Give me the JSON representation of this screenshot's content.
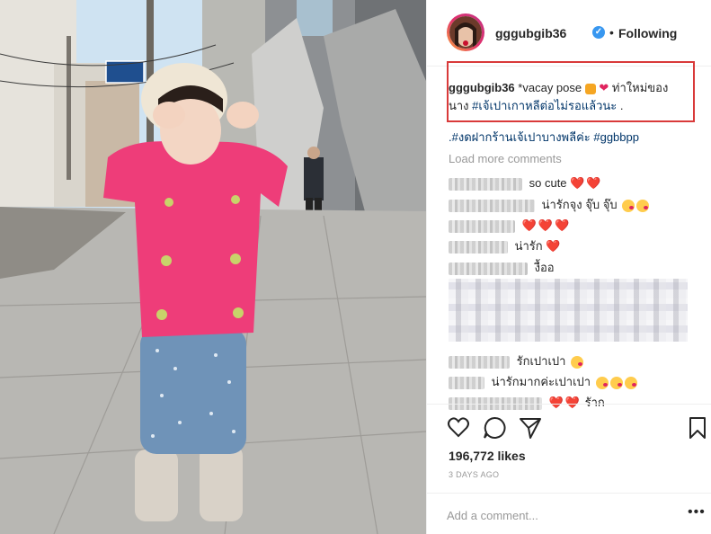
{
  "post": {
    "username": "gggubgib36",
    "verified_badge": "✓",
    "dot": "•",
    "follow_status": "Following"
  },
  "caption": {
    "username": "gggubgib36",
    "text_before": "*vacay pose",
    "text_thai_1": "ท่าใหม่ของ",
    "text_thai_2": "นาง",
    "hashtag_1": "#เจ้เปาเกาหลีต่อไม่รอแล้วนะ",
    "period": ".",
    "line2": ".#งดฝากร้านเจ้เปาบางพลีค่ะ #ggbbpp"
  },
  "load_more": "Load more comments",
  "comments": [
    {
      "text": "so cute",
      "hearts": "❤️❤️"
    },
    {
      "text": "น่ารักจุง จุ๊บ จุ๊บ",
      "emoji_count": 2
    },
    {
      "text": "",
      "hearts": "❤️❤️❤️"
    },
    {
      "text": "น่ารัก",
      "hearts": "❤️"
    },
    {
      "text": "งื้ออ"
    },
    {
      "text": "รักเปาเปา",
      "emoji_count": 1
    },
    {
      "text": "น่ารักมากค่ะเปาเปา",
      "emoji_count": 3
    },
    {
      "text": "รัาก",
      "hearts": "❤️❤️"
    }
  ],
  "likes": "196,772 likes",
  "date": "3 DAYS AGO",
  "add_comment_placeholder": "Add a comment...",
  "more_options": "•••",
  "icons": {
    "like": "heart-outline-icon",
    "comment": "speech-bubble-icon",
    "share": "paper-plane-icon",
    "save": "bookmark-icon"
  },
  "colors": {
    "link": "#003569",
    "verified": "#3897f0",
    "highlight_box": "#d93a3a",
    "heart": "#e0245e"
  }
}
